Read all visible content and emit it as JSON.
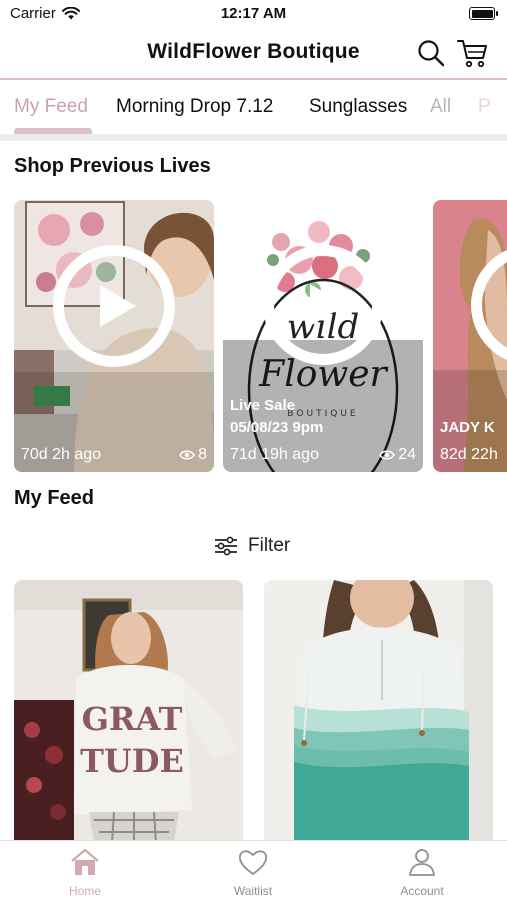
{
  "status_bar": {
    "carrier": "Carrier",
    "time": "12:17 AM"
  },
  "header": {
    "title": "WildFlower Boutique"
  },
  "tabs": [
    {
      "label": "My Feed",
      "active": true
    },
    {
      "label": "Morning Drop 7.12"
    },
    {
      "label": "Sunglasses"
    },
    {
      "label": "All"
    },
    {
      "label": "P"
    }
  ],
  "previous_lives": {
    "title": "Shop Previous Lives",
    "cards": [
      {
        "age": "70d 2h ago",
        "views": "8"
      },
      {
        "caption_line1": "Live Sale",
        "caption_line2": "05/08/23 9pm",
        "age": "71d 19h ago",
        "views": "24"
      },
      {
        "caption_line1": "JADY K",
        "age": "82d 22h"
      }
    ]
  },
  "feed": {
    "title": "My Feed",
    "filter_label": "Filter"
  },
  "tabbar": {
    "items": [
      {
        "label": "Home",
        "icon": "home-icon",
        "active": true
      },
      {
        "label": "Waitlist",
        "icon": "heart-icon"
      },
      {
        "label": "Account",
        "icon": "person-icon"
      }
    ]
  },
  "colors": {
    "accent": "#d1a9b0",
    "tab_active": "#c9a2ab",
    "indicator": "#dcc3c8"
  }
}
